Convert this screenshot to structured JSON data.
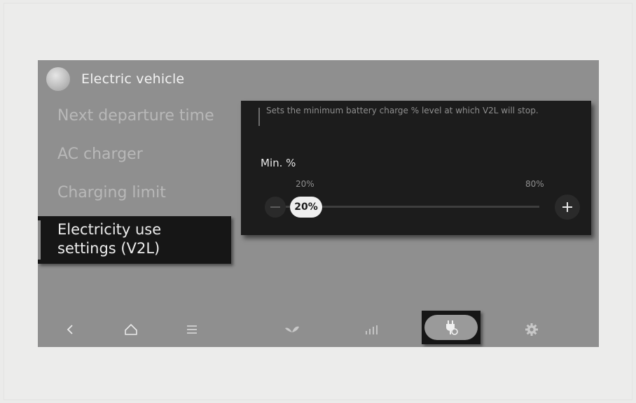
{
  "header": {
    "title": "Electric vehicle",
    "avatar_icon": "vehicle-avatar-icon"
  },
  "menu": {
    "items": [
      {
        "label": "Next departure time"
      },
      {
        "label": "AC charger"
      },
      {
        "label": "Charging limit"
      },
      {
        "label": "Electricity use\nsettings (V2L)",
        "active": true
      }
    ]
  },
  "panel": {
    "description": "Sets the minimum battery charge % level at which V2L will stop.",
    "min_label": "Min. %",
    "slider": {
      "min_label": "20%",
      "max_label": "80%",
      "value_label": "20%",
      "value_fraction": 0.0
    },
    "minus_icon": "minus-icon",
    "plus_icon": "plus-icon"
  },
  "nav": {
    "items": [
      {
        "icon": "back-chevron-icon"
      },
      {
        "icon": "home-icon"
      },
      {
        "icon": "menu-lines-icon"
      },
      {
        "icon": "leaf-eco-icon"
      },
      {
        "icon": "energy-bars-icon"
      },
      {
        "icon": "ev-plug-icon",
        "active": true
      },
      {
        "icon": "gear-icon"
      }
    ]
  },
  "colors": {
    "screen_bg": "#8f8f8f",
    "panel_bg": "#1c1c1c",
    "active_bg": "#161616",
    "text_light": "#f2f2f2",
    "text_muted": "#b8b8b8"
  }
}
